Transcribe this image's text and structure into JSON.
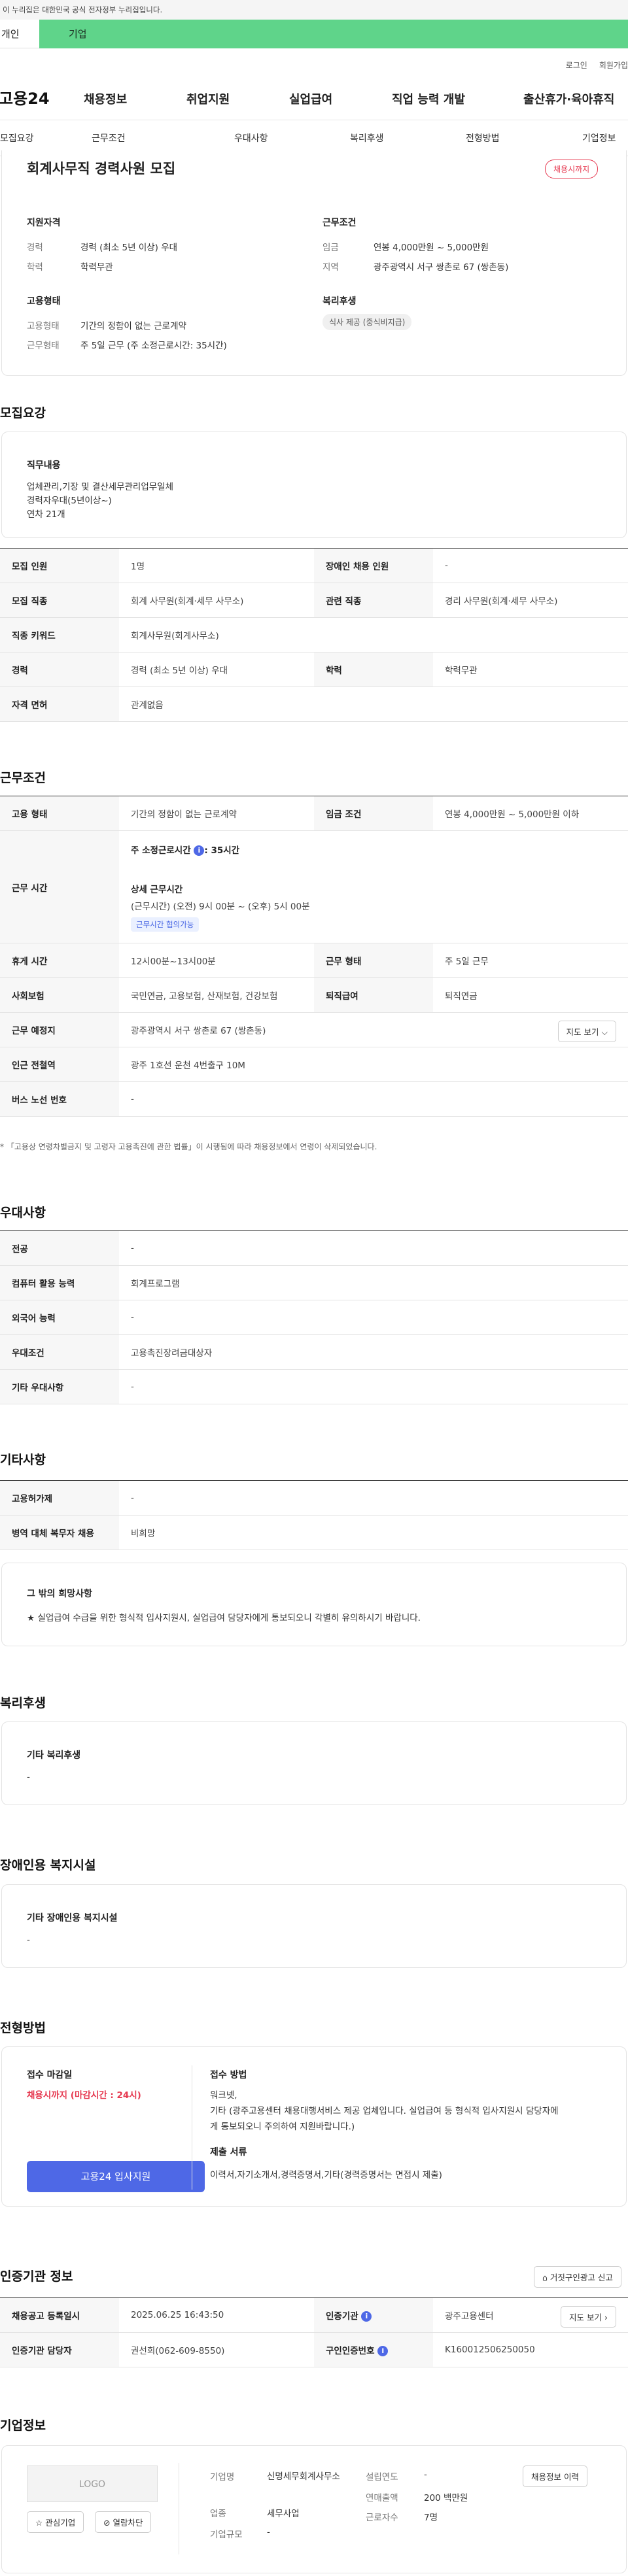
{
  "gov_bar": "이 누리집은 대한민국 공식 전자정부 누리집입니다.",
  "top_tabs": [
    "개인",
    "기업"
  ],
  "util_links": [
    "로그인",
    "회원가입"
  ],
  "logo": "고용24",
  "gnb": [
    "채용정보",
    "취업지원",
    "실업급여",
    "직업 능력 개발",
    "출산휴가·육아휴직"
  ],
  "snb": [
    "모집요강",
    "근무조건",
    "우대사항",
    "복리후생",
    "전형방법",
    "기업정보"
  ],
  "summary": {
    "title": "회계사무직 경력사원 모집",
    "status_badge": "채용시까지",
    "qual_title": "지원자격",
    "qual": [
      {
        "k": "경력",
        "v": "경력 (최소 5년 이상) 우대"
      },
      {
        "k": "학력",
        "v": "학력무관"
      }
    ],
    "emp_title": "고용형태",
    "emp": [
      {
        "k": "고용형태",
        "v": "기간의 정함이 없는 근로계약"
      },
      {
        "k": "근무형태",
        "v": "주 5일 근무 (주 소정근로시간: 35시간)"
      }
    ],
    "work_title": "근무조건",
    "work": [
      {
        "k": "임금",
        "v": "연봉 4,000만원 ~ 5,000만원"
      },
      {
        "k": "지역",
        "v": "광주광역시 서구 쌍촌로 67 (쌍촌동)"
      }
    ],
    "welfare_title": "복리후생",
    "welfare_tag": "식사 제공 (중식비지급)"
  },
  "recruit": {
    "title": "모집요강",
    "duty_title": "직무내용",
    "duty_lines": [
      "업체관리,기장 및 결산세무관리업무일체",
      "경력자우대(5년이상~)",
      "연차 21개"
    ],
    "rows": [
      [
        "모집 인원",
        "1명",
        "장애인 채용 인원",
        "-"
      ],
      [
        "모집 직종",
        "회계 사무원(회계·세무 사무소)",
        "관련 직종",
        "경리 사무원(회계·세무 사무소)"
      ],
      [
        "직종 키워드",
        "회계사무원(회계사무소)"
      ],
      [
        "경력",
        "경력 (최소 5년 이상) 우대",
        "학력",
        "학력무관"
      ],
      [
        "자격 면허",
        "관계없음"
      ]
    ]
  },
  "work": {
    "title": "근무조건",
    "employment_type_label": "고용 형태",
    "employment_type": "기간의 정함이 없는 근로계약",
    "wage_label": "임금 조건",
    "wage": "연봉 4,000만원 ~ 5,000만원 이하",
    "hours_label": "근무 시간",
    "hours_weekly_label": "주 소정근로시간",
    "hours_weekly": ": 35시간",
    "hours_detail_label": "상세 근무시간",
    "hours_detail": "(근무시간) (오전) 9시 00분 ~ (오후) 5시 00분",
    "hours_tag": "근무시간 협의가능",
    "rows": [
      [
        "휴게 시간",
        "12시00분~13시00분",
        "근무 형태",
        "주 5일 근무"
      ],
      [
        "사회보험",
        "국민연금, 고용보험, 산재보험, 건강보험",
        "퇴직급여",
        "퇴직연금"
      ]
    ],
    "place_label": "근무 예정지",
    "place": "광주광역시 서구 쌍촌로 67 (쌍촌동)",
    "map_btn": "지도 보기",
    "subway_label": "인근 전철역",
    "subway": "광주 1호선 운천 4번출구 10M",
    "bus_label": "버스 노선 번호",
    "bus": "-",
    "note": "「고용상 연령차별금지 및 고령자 고용촉진에 관한 법률」이 시행됨에 따라 채용정보에서 연령이 삭제되었습니다."
  },
  "pref": {
    "title": "우대사항",
    "rows": [
      [
        "전공",
        "-"
      ],
      [
        "컴퓨터 활용 능력",
        "회계프로그램"
      ],
      [
        "외국어 능력",
        "-"
      ],
      [
        "우대조건",
        "고용촉진장려금대상자"
      ],
      [
        "기타 우대사항",
        "-"
      ]
    ]
  },
  "etc": {
    "title": "기타사항",
    "rows": [
      [
        "고용허가제",
        "-"
      ],
      [
        "병역 대체 복무자 채용",
        "비희망"
      ]
    ],
    "hope_title": "그 밖의 희망사항",
    "hope_text": "★ 실업급여 수급을 위한 형식적 입사지원시, 실업급여 담당자에게 통보되오니 각별히 유의하시기 바랍니다."
  },
  "welfare": {
    "title": "복리후생",
    "box_title": "기타 복리후생",
    "box_text": "-"
  },
  "disabled": {
    "title": "장애인용 복지시설",
    "box_title": "기타 장애인용 복지시설",
    "box_text": "-"
  },
  "process": {
    "title": "전형방법",
    "deadline_title": "접수 마감일",
    "deadline": "채용시까지 (마감시간 : 24시)",
    "apply_btn": "고용24 입사지원",
    "method_title": "접수 방법",
    "method_lines": [
      "워크넷,",
      "기타 (광주고용센터 채용대행서비스 제공 업체입니다. 실업급여 등 형식적 입사지원시 담당자에",
      "게 통보되오니 주의하여 지원바랍니다.)"
    ],
    "docs_title": "제출 서류",
    "docs": "이력서,자기소개서,경력증명서,기타(경력증명서는 면접시 제출)"
  },
  "cert": {
    "title": "인증기관 정보",
    "report_btn": "거짓구인광고 신고",
    "rows": [
      [
        "채용공고 등록일시",
        "2025.06.25 16:43:50",
        "인증기관",
        "광주고용센터"
      ],
      [
        "인증기관 담당자",
        "권선희(062-609-8550)",
        "구인인증번호",
        "K160012506250050"
      ]
    ],
    "map_btn": "지도 보기"
  },
  "company": {
    "title": "기업정보",
    "logo_text": "LOGO",
    "fav_btn": "관심기업",
    "block_btn": "열람차단",
    "name_label": "기업명",
    "name": "신명세무회계사무소",
    "industry_label": "업종",
    "industry": "세무사업",
    "size_label": "기업규모",
    "size": "-",
    "founded_label": "설립연도",
    "founded": "-",
    "revenue_label": "연매출액",
    "revenue": "200 백만원",
    "employees_label": "근로자수",
    "employees": "7명",
    "history_btn": "채용정보 이력"
  }
}
